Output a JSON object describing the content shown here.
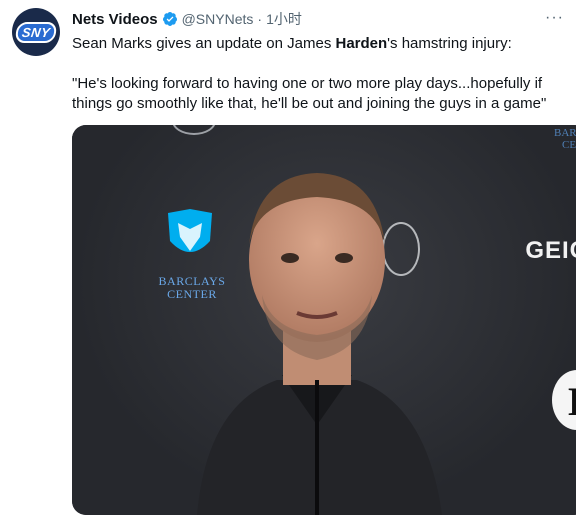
{
  "tweet": {
    "author_name": "Nets Videos",
    "handle": "@SNYNets",
    "separator": "·",
    "time": "1小时",
    "more_glyph": "···",
    "avatar_text": "SNY",
    "line1_pre": "Sean Marks gives an update on James ",
    "line1_bold": "Harden",
    "line1_post": "'s hamstring injury:",
    "quote_line1": "\"He's looking forward to having one or two more play days...hopefully if",
    "quote_line2": "things go smoothly like that, he'll be out and joining the guys in a game\""
  },
  "video": {
    "bc_line1": "BARCLAYS",
    "bc_line2": "CENTER",
    "sponsor": "GEIC",
    "corner_line1": "BARC",
    "corner_line2": "CEN",
    "nets_letter": "B"
  },
  "colors": {
    "verified": "#1d9bf0",
    "secondary_text": "#536471",
    "media_bg": "#2b2d33"
  },
  "icons": {
    "verified": "verified-badge-icon",
    "more": "more-options-icon"
  }
}
